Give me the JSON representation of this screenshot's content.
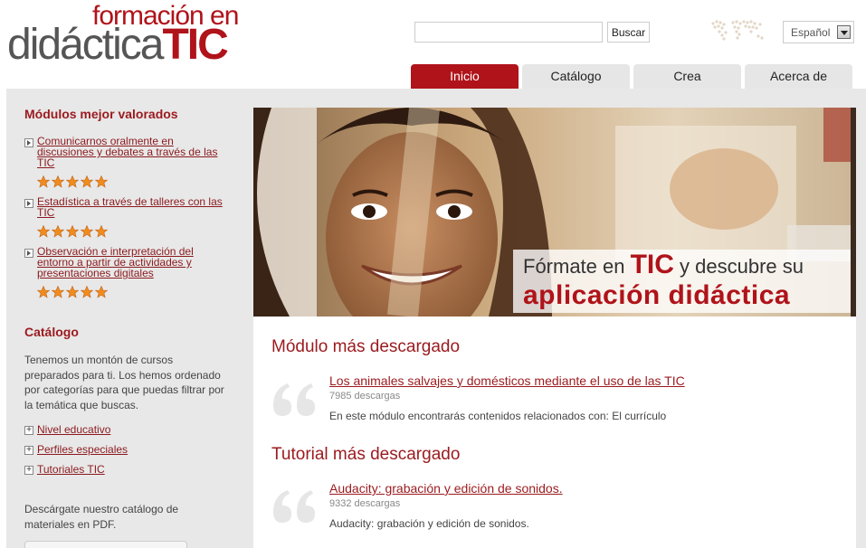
{
  "logo": {
    "line1": "formación en",
    "line2_plain": "didáctica",
    "line2_bold": "TIC"
  },
  "search": {
    "placeholder": "",
    "value": "",
    "button_label": "Buscar"
  },
  "language": {
    "selected": "Español"
  },
  "tabs": [
    {
      "label": "Inicio",
      "active": true
    },
    {
      "label": "Catálogo",
      "active": false
    },
    {
      "label": "Crea",
      "active": false
    },
    {
      "label": "Acerca de",
      "active": false
    }
  ],
  "sidebar": {
    "top_rated": {
      "heading": "Módulos mejor valorados",
      "items": [
        {
          "title_lines": [
            "Comunicarnos oralmente en",
            "discusiones y debates a través de las",
            "TIC"
          ],
          "stars": 5
        },
        {
          "title_lines": [
            "Estadística a través de talleres con las",
            "TIC"
          ],
          "stars": 5
        },
        {
          "title_lines": [
            "Observación e interpretación del",
            "entorno a partir de actividades y",
            "presentaciones digitales"
          ],
          "stars": 5
        }
      ]
    },
    "catalog": {
      "heading": "Catálogo",
      "text_lines": [
        "Tenemos un montón de cursos",
        "preparados para ti. Los hemos ordenado",
        "por categorías para que puedas filtrar por",
        "la temática que buscas."
      ],
      "links": [
        "Nivel educativo",
        "Perfiles especiales",
        "Tutoriales TIC"
      ],
      "download_text_lines": [
        "Descárgate nuestro catálogo de",
        "materiales en PDF."
      ]
    }
  },
  "hero": {
    "caption_line1_a": "Fórmate en ",
    "caption_line1_tic": "TIC",
    "caption_line1_b": " y descubre su",
    "caption_line2": "aplicación didáctica"
  },
  "most_downloaded_module": {
    "heading": "Módulo más descargado",
    "title": "Los animales salvajes y domésticos mediante el uso de las TIC",
    "downloads": "7985 descargas",
    "description": "En este módulo encontrarás contenidos relacionados con: El currículo"
  },
  "most_downloaded_tutorial": {
    "heading": "Tutorial más descargado",
    "title": "Audacity: grabación y edición de sonidos.",
    "downloads": "9332 descargas",
    "description": "Audacity: grabación y edición de sonidos."
  },
  "colors": {
    "brand": "#b0131a",
    "link": "#9b1a1e",
    "star": "#f08c1e",
    "panel_bg": "#e8e8e8"
  }
}
